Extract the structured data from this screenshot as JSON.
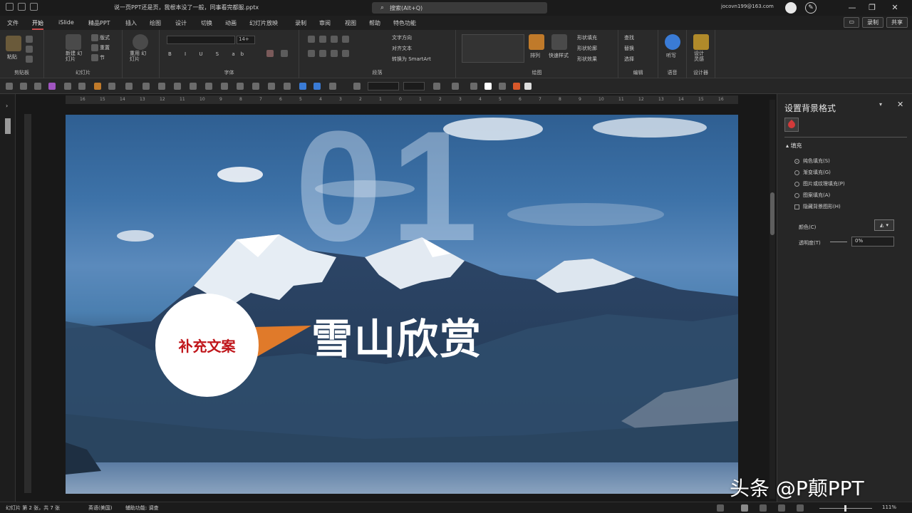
{
  "window": {
    "doc_title": "说一页PPT还是页，我根本没了一般，同事看完都服.pptx",
    "search_placeholder": "搜索(Alt+Q)",
    "account": "jocovn199@163.com",
    "minimize": "—",
    "restore": "❐",
    "close": "✕"
  },
  "tabs": [
    "文件",
    "开始",
    "iSlide",
    "精品PPT",
    "插入",
    "绘图",
    "设计",
    "切换",
    "动画",
    "幻灯片放映",
    "录制",
    "审阅",
    "视图",
    "帮助",
    "特色功能"
  ],
  "active_tab": "开始",
  "share": {
    "comment": "▭",
    "record": "录制",
    "share": "共享"
  },
  "ribbon": {
    "groups": [
      "剪贴板",
      "幻灯片",
      "字体",
      "段落",
      "绘图",
      "编辑",
      "语音",
      "设计器"
    ],
    "paste": "粘贴",
    "new_slide": "新建\n幻灯片",
    "reuse": "重用\n幻灯片",
    "layout": "版式",
    "reset": "重置",
    "section": "节",
    "font_size": "14+",
    "text_direction": "文字方向",
    "align_text": "对齐文本",
    "smartart": "转换为 SmartArt",
    "arrange": "排列",
    "quick_styles": "快速样式",
    "shape_fill": "形状填充",
    "shape_outline": "形状轮廓",
    "shape_effect": "形状效果",
    "find": "查找",
    "replace": "替换",
    "select": "选择",
    "dictate": "听写",
    "designer": "设计\n灵感"
  },
  "slide": {
    "number": "01",
    "badge_text": "补充文案",
    "title": "雪山欣赏"
  },
  "panel": {
    "title": "设置背景格式",
    "dropdown": "▾",
    "close": "✕",
    "section": "填充",
    "options": [
      {
        "label": "纯色填充(S)",
        "type": "radio",
        "checked": true
      },
      {
        "label": "渐变填充(G)",
        "type": "radio",
        "checked": false
      },
      {
        "label": "图片或纹理填充(P)",
        "type": "radio",
        "checked": false
      },
      {
        "label": "图案填充(A)",
        "type": "radio",
        "checked": false
      },
      {
        "label": "隐藏背景图形(H)",
        "type": "checkbox",
        "checked": false
      }
    ],
    "color_label": "颜色(C)",
    "transparency_label": "透明度(T)",
    "transparency_value": "0%"
  },
  "ruler_ticks": [
    "16",
    "15",
    "14",
    "13",
    "12",
    "11",
    "10",
    "9",
    "8",
    "7",
    "6",
    "5",
    "4",
    "3",
    "2",
    "1",
    "0",
    "1",
    "2",
    "3",
    "4",
    "5",
    "6",
    "7",
    "8",
    "9",
    "10",
    "11",
    "12",
    "13",
    "14",
    "15",
    "16"
  ],
  "status": {
    "slide_pos": "幻灯片 第 2 张，共 7 张",
    "language": "英语(美国)",
    "accessibility": "辅助功能: 调查",
    "zoom": "111%"
  },
  "watermark": "头条 @P颠PPT",
  "colors": {
    "accent": "#c94e4e",
    "badge_text": "#c0161b",
    "triangle": "#e07a2a"
  }
}
